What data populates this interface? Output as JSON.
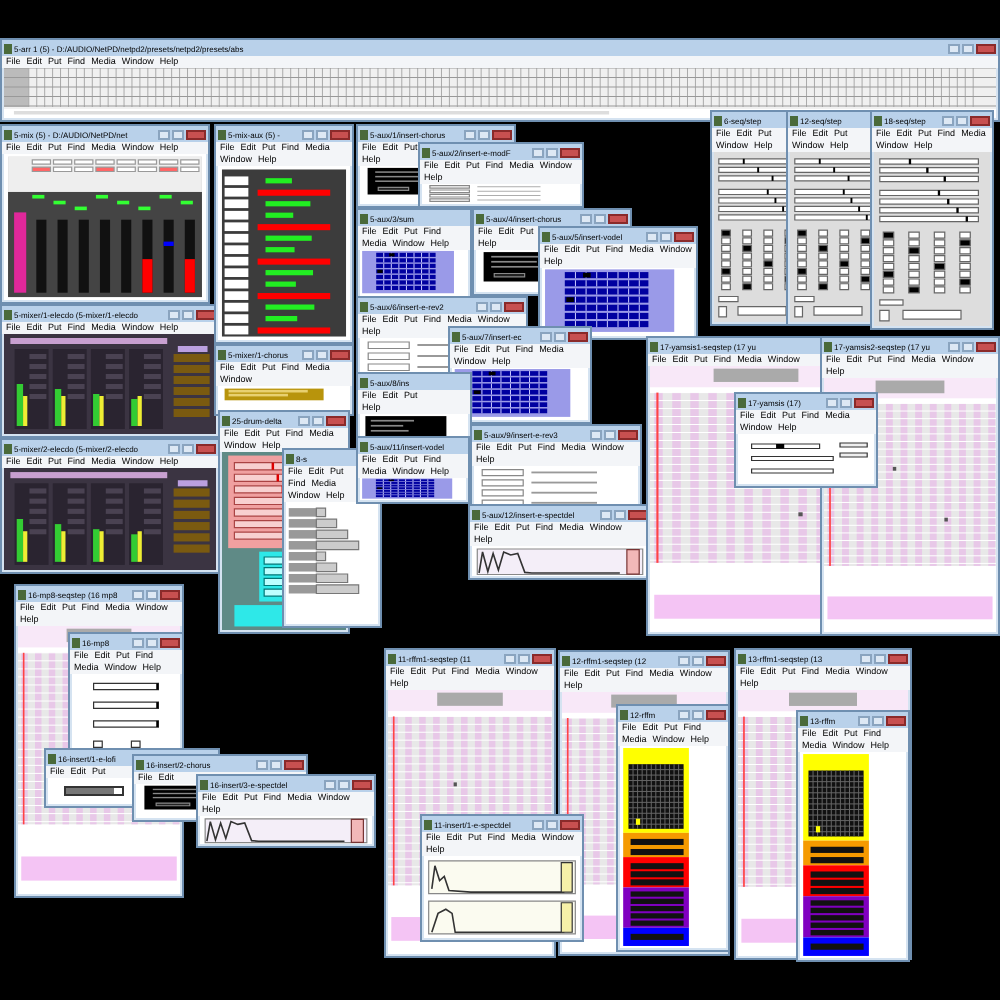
{
  "windows": [
    {
      "title": "5-arr 1 (5) - D:/AUDIO/NetPD/netpd2/presets/netpd2/presets/abs",
      "menu": [
        "File",
        "Edit",
        "Put",
        "Find",
        "Media",
        "Window",
        "Help"
      ],
      "kind": "track-grid"
    },
    {
      "title": "5-mix (5) - D:/AUDIO/NetPD/net",
      "menu": [
        "File",
        "Edit",
        "Put",
        "Find",
        "Media",
        "Window",
        "Help"
      ],
      "kind": "mixer"
    },
    {
      "title": "5-mixer/1-elecdo (5-mixer/1-elecdo",
      "menu": [
        "File",
        "Edit",
        "Put",
        "Find",
        "Media",
        "Window",
        "Help"
      ],
      "kind": "elec-mixer"
    },
    {
      "title": "5-mixer/2-elecdo (5-mixer/2-elecdo",
      "menu": [
        "File",
        "Edit",
        "Put",
        "Find",
        "Media",
        "Window",
        "Help"
      ],
      "kind": "elec-mixer"
    },
    {
      "title": "5-mix-aux (5) -",
      "menu": [
        "File",
        "Edit",
        "Put",
        "Find",
        "Media",
        "Window",
        "Help"
      ],
      "kind": "meters"
    },
    {
      "title": "5-mixer/1-chorus",
      "menu": [
        "File",
        "Edit",
        "Put",
        "Find",
        "Media",
        "Window"
      ],
      "kind": "chorus"
    },
    {
      "title": "25-drum-delta",
      "menu": [
        "File",
        "Edit",
        "Put",
        "Find",
        "Media",
        "Window",
        "Help"
      ],
      "kind": "delay"
    },
    {
      "title": "8-s",
      "menu": [
        "File",
        "Edit",
        "Put",
        "Find",
        "Media",
        "Window",
        "Help"
      ],
      "kind": "bars"
    },
    {
      "title": "5-aux/1/insert-chorus",
      "menu": [
        "File",
        "Edit",
        "Put",
        "Help"
      ],
      "kind": "display"
    },
    {
      "title": "5-aux/2/insert-e-modF",
      "menu": [
        "File",
        "Edit",
        "Put",
        "Find",
        "Media",
        "Window",
        "Help"
      ],
      "kind": "fields"
    },
    {
      "title": "5-aux/3/sum",
      "menu": [
        "File",
        "Edit",
        "Put",
        "Find",
        "Media",
        "Window",
        "Help"
      ],
      "kind": "matrix"
    },
    {
      "title": "5-aux/4/insert-chorus",
      "menu": [
        "File",
        "Edit",
        "Put",
        "Help"
      ],
      "kind": "display"
    },
    {
      "title": "5-aux/5/insert-vodel",
      "menu": [
        "File",
        "Edit",
        "Put",
        "Find",
        "Media",
        "Window",
        "Help"
      ],
      "kind": "matrix"
    },
    {
      "title": "5-aux/6/insert-e-rev2",
      "menu": [
        "File",
        "Edit",
        "Put",
        "Find",
        "Media",
        "Window",
        "Help"
      ],
      "kind": "fields"
    },
    {
      "title": "5-aux/7/insert-ec",
      "menu": [
        "File",
        "Edit",
        "Put",
        "Find",
        "Media",
        "Window",
        "Help"
      ],
      "kind": "matrix"
    },
    {
      "title": "5-aux/8/ins",
      "menu": [
        "File",
        "Edit",
        "Put",
        "Help"
      ],
      "kind": "display"
    },
    {
      "title": "5-aux/11/insert-vodel",
      "menu": [
        "File",
        "Edit",
        "Put",
        "Find",
        "Media",
        "Window",
        "Help"
      ],
      "kind": "matrix"
    },
    {
      "title": "5-aux/9/insert-e-rev3",
      "menu": [
        "File",
        "Edit",
        "Put",
        "Find",
        "Media",
        "Window",
        "Help"
      ],
      "kind": "fields"
    },
    {
      "title": "5-aux/12/insert-e-spectdel",
      "menu": [
        "File",
        "Edit",
        "Put",
        "Find",
        "Media",
        "Window",
        "Help"
      ],
      "kind": "graph"
    },
    {
      "title": "6-seq/step",
      "menu": [
        "File",
        "Edit",
        "Put",
        "Window",
        "Help"
      ],
      "kind": "seq-panel"
    },
    {
      "title": "12-seq/step",
      "menu": [
        "File",
        "Edit",
        "Put",
        "Window",
        "Help"
      ],
      "kind": "seq-panel"
    },
    {
      "title": "18-seq/step",
      "menu": [
        "File",
        "Edit",
        "Put",
        "Find",
        "Media",
        "Window",
        "Help"
      ],
      "kind": "seq-panel"
    },
    {
      "title": "17-yamsis1-seqstep (17 yu",
      "menu": [
        "File",
        "Edit",
        "Put",
        "Find",
        "Media",
        "Window"
      ],
      "kind": "step-grid"
    },
    {
      "title": "17-yamsis2-seqstep (17 yu",
      "menu": [
        "File",
        "Edit",
        "Put",
        "Find",
        "Media",
        "Window",
        "Help"
      ],
      "kind": "step-grid"
    },
    {
      "title": "17-yamsis (17)",
      "menu": [
        "File",
        "Edit",
        "Put",
        "Find",
        "Media",
        "Window",
        "Help"
      ],
      "kind": "toggle-form"
    },
    {
      "title": "16-mp8-seqstep (16 mp8",
      "menu": [
        "File",
        "Edit",
        "Put",
        "Find",
        "Media",
        "Window",
        "Help"
      ],
      "kind": "step-grid"
    },
    {
      "title": "16-mp8",
      "menu": [
        "File",
        "Edit",
        "Put",
        "Find",
        "Media",
        "Window",
        "Help"
      ],
      "kind": "form"
    },
    {
      "title": "16-insert/1-e-lofi",
      "menu": [
        "File",
        "Edit",
        "Put"
      ],
      "kind": "bar-panel",
      "level": 0.85
    },
    {
      "title": "16-insert/2-chorus",
      "menu": [
        "File",
        "Edit"
      ],
      "kind": "display"
    },
    {
      "title": "16-insert/3-e-spectdel",
      "menu": [
        "File",
        "Edit",
        "Put",
        "Find",
        "Media",
        "Window",
        "Help"
      ],
      "kind": "graph"
    },
    {
      "title": "11-rffm1-seqstep (11",
      "menu": [
        "File",
        "Edit",
        "Put",
        "Find",
        "Media",
        "Window",
        "Help"
      ],
      "kind": "step-grid"
    },
    {
      "title": "12-rffm1-seqstep (12",
      "menu": [
        "File",
        "Edit",
        "Put",
        "Find",
        "Media",
        "Window",
        "Help"
      ],
      "kind": "step-grid"
    },
    {
      "title": "12-rffm",
      "menu": [
        "File",
        "Edit",
        "Put",
        "Find",
        "Media",
        "Window",
        "Help"
      ],
      "kind": "color-stack"
    },
    {
      "title": "13-rffm1-seqstep (13",
      "menu": [
        "File",
        "Edit",
        "Put",
        "Find",
        "Media",
        "Window",
        "Help"
      ],
      "kind": "step-grid"
    },
    {
      "title": "13-rffm",
      "menu": [
        "File",
        "Edit",
        "Put",
        "Find",
        "Media",
        "Window",
        "Help"
      ],
      "kind": "color-stack"
    },
    {
      "title": "11-insert/1-e-spectdel",
      "menu": [
        "File",
        "Edit",
        "Put",
        "Find",
        "Media",
        "Window",
        "Help"
      ],
      "kind": "graph2"
    }
  ]
}
